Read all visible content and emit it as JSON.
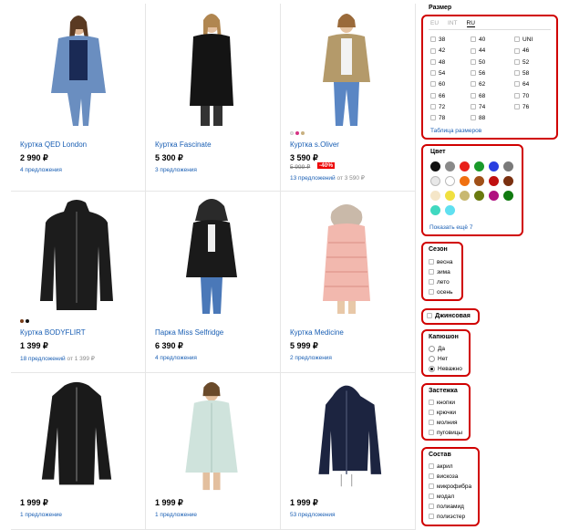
{
  "products": [
    {
      "title": "Куртка QED London",
      "price": "2 990 ₽",
      "offers": "4 предложения",
      "offers_from": "",
      "old_price": "",
      "discount": "",
      "swatches": []
    },
    {
      "title": "Куртка Fascinate",
      "price": "5 300 ₽",
      "offers": "3 предложения",
      "offers_from": "",
      "old_price": "",
      "discount": "",
      "swatches": []
    },
    {
      "title": "Куртка s.Oliver",
      "price": "3 590 ₽",
      "offers": "13 предложений",
      "offers_from": "от 3 590 ₽",
      "old_price": "5 999 ₽",
      "discount": "-40%",
      "swatches": [
        "#e8e8e8",
        "#d63384",
        "#c8b080"
      ]
    },
    {
      "title": "Куртка BODYFLIRT",
      "price": "1 399 ₽",
      "offers": "18 предложений",
      "offers_from": "от 1 399 ₽",
      "old_price": "",
      "discount": "",
      "swatches": [
        "#7a3e1a",
        "#111111"
      ]
    },
    {
      "title": "Парка Miss Selfridge",
      "price": "6 390 ₽",
      "offers": "4 предложения",
      "offers_from": "",
      "old_price": "",
      "discount": "",
      "swatches": []
    },
    {
      "title": "Куртка Medicine",
      "price": "5 999 ₽",
      "offers": "2 предложения",
      "offers_from": "",
      "old_price": "",
      "discount": "",
      "swatches": []
    },
    {
      "title": "",
      "price": "1 999 ₽",
      "offers": "1 предложение",
      "offers_from": "",
      "old_price": "",
      "discount": "",
      "swatches": []
    },
    {
      "title": "",
      "price": "1 999 ₽",
      "offers": "1 предложение",
      "offers_from": "",
      "old_price": "",
      "discount": "",
      "swatches": []
    },
    {
      "title": "",
      "price": "1 999 ₽",
      "offers": "53 предложения",
      "offers_from": "",
      "old_price": "",
      "discount": "",
      "swatches": []
    }
  ],
  "filters": {
    "size": {
      "title": "Размер",
      "tabs": [
        "EU",
        "INT",
        "RU"
      ],
      "active_tab": "RU",
      "options": [
        "38",
        "40",
        "UNI",
        "42",
        "44",
        "46",
        "48",
        "50",
        "52",
        "54",
        "56",
        "58",
        "60",
        "62",
        "64",
        "66",
        "68",
        "70",
        "72",
        "74",
        "76",
        "78",
        "88"
      ],
      "link": "Таблица размеров"
    },
    "color": {
      "title": "Цвет",
      "colors": [
        "#111111",
        "#8a8a8a",
        "#e8201a",
        "#1a9a2a",
        "#2a3fe0",
        "#7a7a7a",
        "#e8e8e8",
        "#ffffff",
        "#f07010",
        "#a05018",
        "#c01010",
        "#7a3010",
        "#f5e6c8",
        "#f0e040",
        "#c8b870",
        "#6a7a10",
        "#b01080",
        "#107a10",
        "#40d8c0",
        "#60e0f0"
      ],
      "link": "Показать ещё 7"
    },
    "season": {
      "title": "Сезон",
      "options": [
        "весна",
        "зима",
        "лето",
        "осень"
      ]
    },
    "denim": {
      "label": "Джинсовая"
    },
    "hood": {
      "title": "Капюшон",
      "options": [
        "Да",
        "Нет",
        "Неважно"
      ],
      "selected": "Неважно"
    },
    "fastener": {
      "title": "Застежка",
      "options": [
        "кнопки",
        "крючки",
        "молния",
        "пуговицы"
      ]
    },
    "composition": {
      "title": "Состав",
      "options": [
        "акрил",
        "вискоза",
        "микрофибра",
        "модал",
        "полиамид",
        "полиэстер"
      ]
    }
  }
}
